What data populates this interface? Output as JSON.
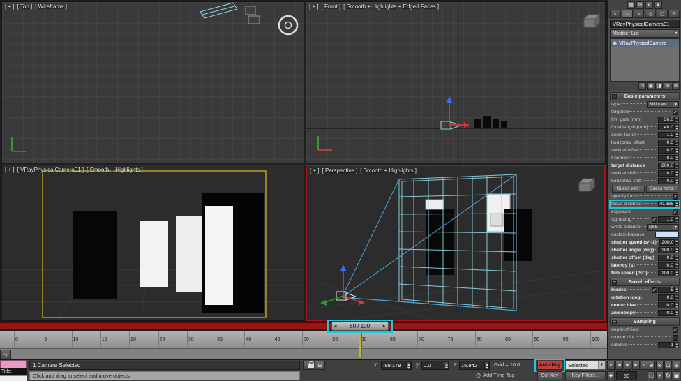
{
  "colors": {
    "annotation": "#19c8dc",
    "autokey_red": "#c23c3c",
    "active_viewport_border": "#a81414",
    "camera_viewport_yellow": "#b5a229",
    "listener_pink": "#e89cc5",
    "selection_wireframe": "#8fd4e4"
  },
  "icons": {
    "dropdown_arrow": "▼",
    "check": "✓",
    "rollout_collapse": "−",
    "slider_left": "◄",
    "slider_right": "►",
    "curve_editor": "∿",
    "clock": "◷",
    "abs_offset": "⊞",
    "key_mode": "◆"
  },
  "toolbar_top_icons": [
    {
      "name": "layer-manager-icon",
      "glyph": "▦"
    },
    {
      "name": "render-setup-icon",
      "glyph": "⚙"
    },
    {
      "name": "rendered-frame-window-icon",
      "glyph": "◐"
    },
    {
      "name": "render-production-icon",
      "glyph": "●"
    }
  ],
  "command_panel": {
    "tabs": [
      {
        "name": "tab-create",
        "glyph": "↖",
        "active": false
      },
      {
        "name": "tab-modify",
        "glyph": "∿",
        "active": true
      },
      {
        "name": "tab-hierarchy",
        "glyph": "≡",
        "active": false
      },
      {
        "name": "tab-motion",
        "glyph": "◎",
        "active": false
      },
      {
        "name": "tab-display",
        "glyph": "▢",
        "active": false
      },
      {
        "name": "tab-utilities",
        "glyph": "⚙",
        "active": false
      }
    ],
    "object_name": "VRayPhysicalCamera01",
    "modifier_list_label": "Modifier List",
    "stack_items": [
      {
        "label": "VRayPhysicalCamera",
        "icon": "◉",
        "selected": true
      }
    ],
    "stack_buttons": [
      {
        "name": "pin-stack-icon",
        "glyph": "⊙"
      },
      {
        "name": "show-end-result-icon",
        "glyph": "▣"
      },
      {
        "name": "make-unique-icon",
        "glyph": "◨"
      },
      {
        "name": "remove-modifier-icon",
        "glyph": "⊗"
      },
      {
        "name": "configure-modifier-sets-icon",
        "glyph": "≣"
      }
    ],
    "rollouts": [
      {
        "title": "Basic parameters",
        "rows": [
          {
            "label": "type",
            "type": "dropdown",
            "value": "Still cam"
          },
          {
            "label": "targeted",
            "type": "check",
            "checked": true
          },
          {
            "label": "film gate (mm)",
            "type": "spinner",
            "value": "36.0"
          },
          {
            "label": "focal length (mm)",
            "type": "spinner",
            "value": "40.0"
          },
          {
            "label": "zoom factor",
            "type": "spinner",
            "value": "1.0"
          },
          {
            "label": "horizontal offset",
            "type": "spinner",
            "value": "0.0"
          },
          {
            "label": "vertical offset",
            "type": "spinner",
            "value": "0.0"
          },
          {
            "label": "f-number",
            "type": "spinner",
            "value": "8.0"
          },
          {
            "label": "target distance",
            "type": "spinner",
            "value": "200.0",
            "bold": true
          },
          {
            "label": "vertical shift",
            "type": "spinner",
            "value": "0.0"
          },
          {
            "label": "horizontal shift",
            "type": "spinner",
            "value": "0.0"
          },
          {
            "type": "buttons",
            "buttons": [
              "Guess vert.",
              "Guess horiz."
            ]
          },
          {
            "label": "specify focus",
            "type": "check",
            "checked": true
          },
          {
            "label": "focus distance",
            "type": "spinner",
            "value": "70.886",
            "highlight": true
          },
          {
            "label": "exposure",
            "type": "check",
            "checked": true
          },
          {
            "label": "vignetting",
            "type": "checkspinner",
            "checked": true,
            "value": "1.0"
          },
          {
            "label": "white balance",
            "type": "dropdown",
            "value": "D65"
          },
          {
            "label": "custom balance",
            "type": "swatch",
            "value": "#cfe2f3"
          },
          {
            "label": "shutter speed (s^-1)",
            "type": "spinner",
            "value": "200.0",
            "bold": true
          },
          {
            "label": "shutter angle (deg)",
            "type": "spinner",
            "value": "180.0",
            "bold": true
          },
          {
            "label": "shutter offset (deg)",
            "type": "spinner",
            "value": "0.0",
            "bold": true
          },
          {
            "label": "latency (s)",
            "type": "spinner",
            "value": "0.0",
            "bold": true
          },
          {
            "label": "film speed (ISO)",
            "type": "spinner",
            "value": "100.0",
            "bold": true
          }
        ]
      },
      {
        "title": "Bokeh effects",
        "rows": [
          {
            "label": "blades",
            "type": "checkspinner",
            "checked": true,
            "value": "5",
            "bold": true
          },
          {
            "label": "rotation (deg)",
            "type": "spinner",
            "value": "0.0",
            "bold": true
          },
          {
            "label": "center bias",
            "type": "spinner",
            "value": "0.0",
            "bold": true
          },
          {
            "label": "anisotropy",
            "type": "spinner",
            "value": "0.0",
            "bold": true
          }
        ]
      },
      {
        "title": "Sampling",
        "rows": [
          {
            "label": "depth-of-field",
            "type": "check",
            "checked": true
          },
          {
            "label": "motion blur",
            "type": "check",
            "checked": false
          },
          {
            "label": "subdivs",
            "type": "spinner",
            "value": "1"
          }
        ]
      }
    ]
  },
  "viewports": {
    "top": {
      "plus": "[ + ]",
      "name": "[ Top ]",
      "shading": "[ Wireframe ]"
    },
    "front": {
      "plus": "[ + ]",
      "name": "[ Front ]",
      "shading": "[ Smooth + Highlights + Edged Faces ]"
    },
    "camera": {
      "plus": "[ + ]",
      "name": "[ VRayPhysicalCamera01 ]",
      "shading": "[ Smooth + Highlights ]"
    },
    "perspective": {
      "plus": "[ + ]",
      "name": "[ Perspective ]",
      "shading": "[ Smooth + Highlights ]"
    }
  },
  "timeline": {
    "slider_label": "60 / 100",
    "current_frame": 60,
    "current_frame_display": "60",
    "tick_start": 0,
    "tick_end": 100,
    "tick_step": 5
  },
  "playback_buttons": [
    {
      "name": "go-to-start-button",
      "glyph": "«"
    },
    {
      "name": "previous-frame-button",
      "glyph": "◄"
    },
    {
      "name": "play-button",
      "glyph": "►"
    },
    {
      "name": "next-frame-button",
      "glyph": "►"
    },
    {
      "name": "go-to-end-button",
      "glyph": "»"
    }
  ],
  "nav_buttons_row1": [
    {
      "name": "zoom-icon",
      "glyph": "⊕"
    },
    {
      "name": "zoom-all-icon",
      "glyph": "⊗"
    },
    {
      "name": "zoom-extents-icon",
      "glyph": "⊡"
    },
    {
      "name": "zoom-extents-all-icon",
      "glyph": "⊞"
    }
  ],
  "nav_buttons_row2": [
    {
      "name": "zoom-region-icon",
      "glyph": "▭"
    },
    {
      "name": "pan-icon",
      "glyph": "+"
    },
    {
      "name": "orbit-icon",
      "glyph": "↻"
    },
    {
      "name": "maximize-viewport-icon",
      "glyph": "▣"
    }
  ],
  "status": {
    "selection_text": "1 Camera Selected",
    "prompt_text": "Click and drag to select and move objects",
    "listener_title": "Title:",
    "coord_x_label": "x:",
    "coord_x": "-99.179",
    "coord_y_label": "y:",
    "coord_y": "0.0",
    "coord_z_label": "z:",
    "coord_z": "16.942",
    "grid_text": "Grid = 10.0",
    "auto_key_label": "Auto Key",
    "set_key_label": "Set Key",
    "selected_label": "Selected",
    "key_filters_label": "Key Filters...",
    "add_time_tag": "Add Time Tag"
  }
}
